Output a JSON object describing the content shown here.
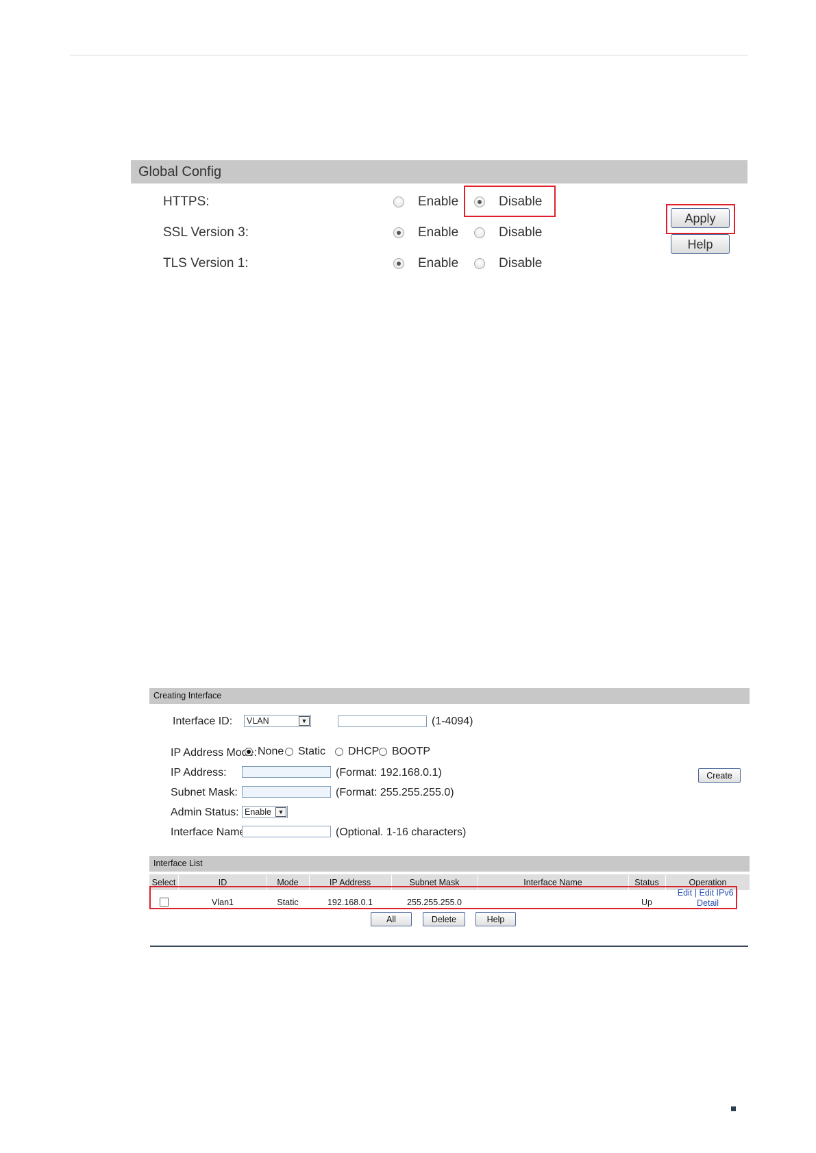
{
  "global_config": {
    "title": "Global Config",
    "rows": [
      {
        "label": "HTTPS:",
        "enable_label": "Enable",
        "disable_label": "Disable",
        "selected": "Disable"
      },
      {
        "label": "SSL Version 3:",
        "enable_label": "Enable",
        "disable_label": "Disable",
        "selected": "Enable"
      },
      {
        "label": "TLS Version 1:",
        "enable_label": "Enable",
        "disable_label": "Disable",
        "selected": "Enable"
      }
    ],
    "apply_label": "Apply",
    "help_label": "Help",
    "highlight_color": "#e0202a"
  },
  "creating_interface": {
    "title": "Creating Interface",
    "interface_id_label": "Interface ID:",
    "interface_type_value": "VLAN",
    "interface_id_value": "",
    "interface_id_hint": "(1-4094)",
    "ip_mode_label": "IP Address Mode:",
    "ip_modes": [
      "None",
      "Static",
      "DHCP",
      "BOOTP"
    ],
    "ip_mode_selected": "None",
    "ip_address_label": "IP Address:",
    "ip_address_hint": "(Format: 192.168.0.1)",
    "subnet_mask_label": "Subnet Mask:",
    "subnet_mask_hint": "(Format: 255.255.255.0)",
    "admin_status_label": "Admin Status:",
    "admin_status_value": "Enable",
    "interface_name_label": "Interface Name:",
    "interface_name_hint": "(Optional. 1-16 characters)",
    "create_label": "Create"
  },
  "interface_list": {
    "title": "Interface List",
    "columns": [
      "Select",
      "ID",
      "Mode",
      "IP Address",
      "Subnet Mask",
      "Interface Name",
      "Status",
      "Operation"
    ],
    "rows": [
      {
        "id": "Vlan1",
        "mode": "Static",
        "ip": "192.168.0.1",
        "mask": "255.255.255.0",
        "name": "",
        "status": "Up",
        "op_edit": "Edit",
        "op_sep1": "|",
        "op_edit_ipv6": "Edit IPv6",
        "op_sep2": "|",
        "op_detail": "Detail"
      }
    ],
    "buttons": {
      "all": "All",
      "delete": "Delete",
      "help": "Help"
    }
  }
}
